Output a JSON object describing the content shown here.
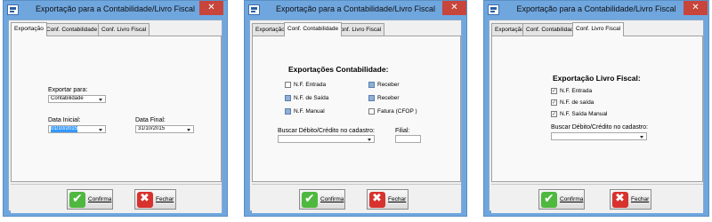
{
  "app": {
    "title": "Exportação para a Contabilidade/Livro Fiscal",
    "close_glyph": "✕",
    "icon": "app-icon"
  },
  "tabs": {
    "exportacao": "Exportação",
    "contabilidade": "Conf. Contabilidade",
    "livro_fiscal": "Conf. Livro Fiscal"
  },
  "buttons": {
    "confirm": "Confirma",
    "close": "Fechar",
    "confirm_icon": "check-icon",
    "close_icon": "x-icon"
  },
  "window1": {
    "active_tab": "Exportação",
    "export_label": "Exportar para:",
    "export_value": "Contabilidade",
    "start_label": "Data Inicial:",
    "start_value": "01/10/2015",
    "end_label": "Data Final:",
    "end_value": "31/10/2015"
  },
  "window2": {
    "active_tab": "Conf. Contabilidade",
    "heading": "Exportações Contabilidade:",
    "checks": [
      {
        "label": "N.F. Entrada",
        "checked": false
      },
      {
        "label": "N.F. de Saída",
        "checked": true
      },
      {
        "label": "N.F. Manual",
        "checked": true
      },
      {
        "label": "Receber",
        "checked": true
      },
      {
        "label": "Receber",
        "checked": true
      },
      {
        "label": "Fatura (CFOP )",
        "checked": false
      }
    ],
    "search_label": "Buscar Débito/Crédito no cadastro:",
    "search_value": "",
    "branch_label": "Filial:",
    "branch_value": ""
  },
  "window3": {
    "active_tab": "Conf. Livro Fiscal",
    "heading": "Exportação Livro Fiscal:",
    "checks": [
      {
        "label": "N.F. Entrada",
        "checked": true
      },
      {
        "label": "N.F. de saída",
        "checked": true
      },
      {
        "label": "N.F. Saída Manual",
        "checked": true
      }
    ],
    "search_label": "Buscar Débito/Crédito no cadastro:",
    "search_value": ""
  },
  "colors": {
    "titlebar": "#6fa6de",
    "close": "#c7453b",
    "client": "#f0f0f0",
    "selection": "#3399ff",
    "confirm_icon": "#4fb83f",
    "close_icon": "#d8322e"
  }
}
